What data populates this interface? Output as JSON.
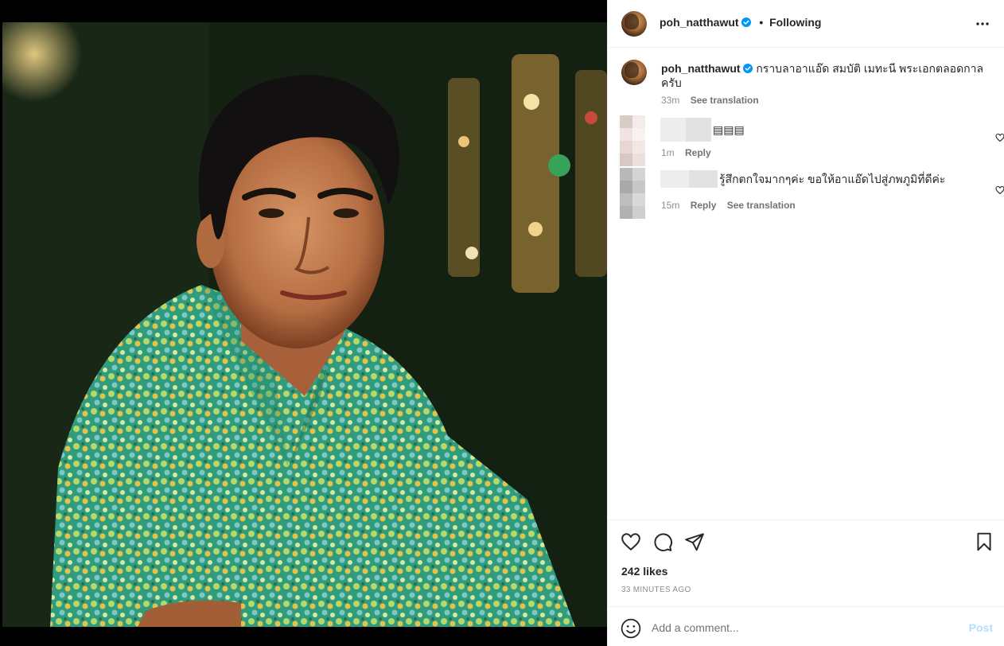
{
  "post": {
    "username": "poh_natthawut",
    "follow_status": "Following",
    "separator": "•"
  },
  "caption": {
    "username": "poh_natthawut",
    "text": "กราบลาอาแอ๊ด สมบัติ เมทะนี พระเอกตลอดกาล ครับ",
    "time": "33m",
    "see_translation": "See translation"
  },
  "comments": [
    {
      "text": "▤▤▤",
      "time": "1m",
      "reply": "Reply",
      "avatar_colors": [
        "#d9cbc6",
        "#f3ecea",
        "#efe4e1",
        "#f8f2f0",
        "#e6d7d3",
        "#f1e7e4",
        "#d8c7c2",
        "#eddfdb"
      ]
    },
    {
      "text": "รู้สึกตกใจมากๆค่ะ ขอให้อาแอ๊ดไปสู่ภพภูมิที่ดีค่ะ",
      "time": "15m",
      "reply": "Reply",
      "see_translation": "See translation",
      "avatar_colors": [
        "#b9b9b9",
        "#d4d4d4",
        "#a9a9a9",
        "#c7c7c7",
        "#bdbdbd",
        "#d8d8d8",
        "#b1b1b1",
        "#cfcfcf"
      ]
    }
  ],
  "actions": {
    "likes": "242 likes",
    "time": "33 MINUTES AGO"
  },
  "add_comment": {
    "placeholder": "Add a comment...",
    "post_label": "Post"
  },
  "colors": {
    "verified": "#0095f6",
    "post_disabled": "#b2dffc",
    "muted": "#8e8e8e"
  }
}
